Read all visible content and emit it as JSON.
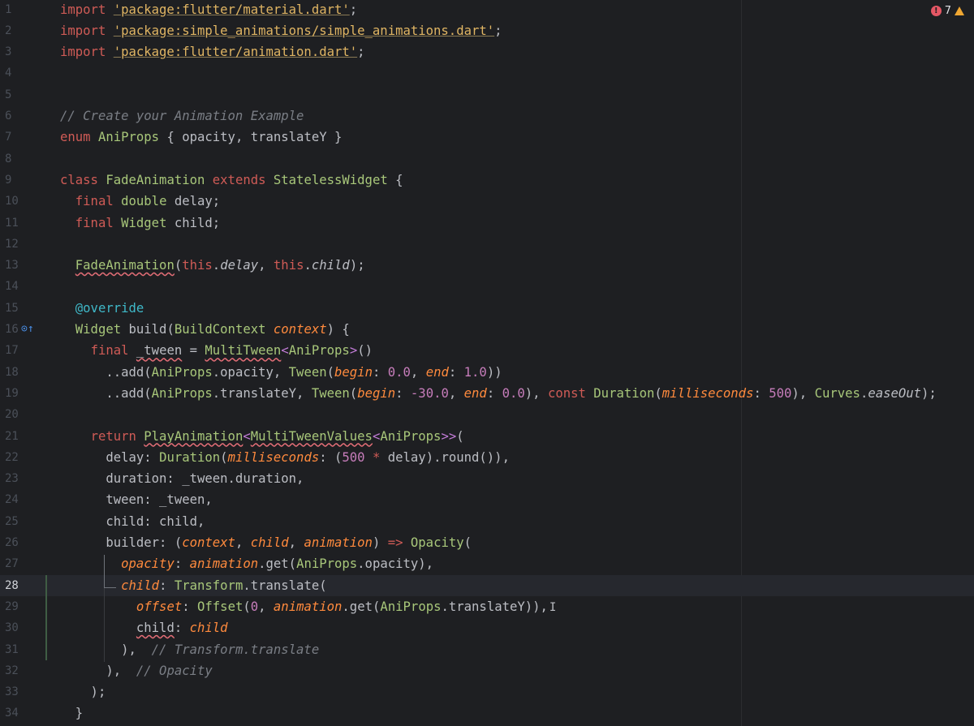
{
  "inspection": {
    "errors": "7",
    "error_icon": "!",
    "colors": {
      "error": "#e55765",
      "warning": "#f0a732"
    }
  },
  "gutter_marks": {
    "line16": "⊙↑"
  },
  "lines": [
    {
      "n": "1",
      "segs": [
        [
          "kw",
          "import "
        ],
        [
          "str",
          "'package:flutter/material.dart'"
        ],
        [
          "plain",
          ";"
        ]
      ]
    },
    {
      "n": "2",
      "segs": [
        [
          "kw",
          "import "
        ],
        [
          "str",
          "'package:simple_animations/simple_animations.dart'"
        ],
        [
          "plain",
          ";"
        ]
      ]
    },
    {
      "n": "3",
      "segs": [
        [
          "kw",
          "import "
        ],
        [
          "str",
          "'package:flutter/animation.dart'"
        ],
        [
          "plain",
          ";"
        ]
      ]
    },
    {
      "n": "4",
      "segs": []
    },
    {
      "n": "5",
      "segs": []
    },
    {
      "n": "6",
      "segs": [
        [
          "cmt",
          "// Create your Animation Example"
        ]
      ]
    },
    {
      "n": "7",
      "segs": [
        [
          "kw",
          "enum "
        ],
        [
          "cls",
          "AniProps"
        ],
        [
          "plain",
          " { opacity, translateY }"
        ]
      ]
    },
    {
      "n": "8",
      "segs": []
    },
    {
      "n": "9",
      "segs": [
        [
          "kw",
          "class "
        ],
        [
          "cls",
          "FadeAnimation "
        ],
        [
          "kw",
          "extends "
        ],
        [
          "cls",
          "StatelessWidget"
        ],
        [
          "plain",
          " {"
        ]
      ]
    },
    {
      "n": "10",
      "segs": [
        [
          "plain",
          "  "
        ],
        [
          "kw",
          "final "
        ],
        [
          "cls",
          "double "
        ],
        [
          "plain",
          "delay;"
        ]
      ]
    },
    {
      "n": "11",
      "segs": [
        [
          "plain",
          "  "
        ],
        [
          "kw",
          "final "
        ],
        [
          "cls",
          "Widget "
        ],
        [
          "plain",
          "child;"
        ]
      ]
    },
    {
      "n": "12",
      "segs": []
    },
    {
      "n": "13",
      "segs": [
        [
          "plain",
          "  "
        ],
        [
          "cls-u",
          "FadeAnimation"
        ],
        [
          "plain",
          "("
        ],
        [
          "kw",
          "this"
        ],
        [
          "plain",
          "."
        ],
        [
          "ital",
          "delay"
        ],
        [
          "plain",
          ", "
        ],
        [
          "kw",
          "this"
        ],
        [
          "plain",
          "."
        ],
        [
          "ital",
          "child"
        ],
        [
          "plain",
          ");"
        ]
      ]
    },
    {
      "n": "14",
      "segs": []
    },
    {
      "n": "15",
      "segs": [
        [
          "plain",
          "  "
        ],
        [
          "anno",
          "@override"
        ]
      ]
    },
    {
      "n": "16",
      "segs": [
        [
          "plain",
          "  "
        ],
        [
          "cls",
          "Widget "
        ],
        [
          "plain",
          "build("
        ],
        [
          "cls",
          "BuildContext "
        ],
        [
          "param",
          "context"
        ],
        [
          "plain",
          ") {"
        ]
      ]
    },
    {
      "n": "17",
      "segs": [
        [
          "plain",
          "    "
        ],
        [
          "kw",
          "final "
        ],
        [
          "plain-u",
          "_tween"
        ],
        [
          "plain",
          " = "
        ],
        [
          "cls-u",
          "MultiTween"
        ],
        [
          "gen",
          "<"
        ],
        [
          "cls",
          "AniProps"
        ],
        [
          "gen",
          ">"
        ],
        [
          "plain",
          "()"
        ]
      ]
    },
    {
      "n": "18",
      "segs": [
        [
          "plain",
          "      ..add("
        ],
        [
          "cls",
          "AniProps"
        ],
        [
          "plain",
          ".opacity, "
        ],
        [
          "cls",
          "Tween"
        ],
        [
          "plain",
          "("
        ],
        [
          "param",
          "begin"
        ],
        [
          "plain",
          ": "
        ],
        [
          "num-l",
          "0.0"
        ],
        [
          "plain",
          ", "
        ],
        [
          "param",
          "end"
        ],
        [
          "plain",
          ": "
        ],
        [
          "num-l",
          "1.0"
        ],
        [
          "plain",
          "))"
        ]
      ]
    },
    {
      "n": "19",
      "segs": [
        [
          "plain",
          "      ..add("
        ],
        [
          "cls",
          "AniProps"
        ],
        [
          "plain",
          ".translateY, "
        ],
        [
          "cls",
          "Tween"
        ],
        [
          "plain",
          "("
        ],
        [
          "param",
          "begin"
        ],
        [
          "plain",
          ": "
        ],
        [
          "num-l",
          "-30.0"
        ],
        [
          "plain",
          ", "
        ],
        [
          "param",
          "end"
        ],
        [
          "plain",
          ": "
        ],
        [
          "num-l",
          "0.0"
        ],
        [
          "plain",
          "), "
        ],
        [
          "kw",
          "const "
        ],
        [
          "cls",
          "Duration"
        ],
        [
          "plain",
          "("
        ],
        [
          "param",
          "milliseconds"
        ],
        [
          "plain",
          ": "
        ],
        [
          "num-l",
          "500"
        ],
        [
          "plain",
          "), "
        ],
        [
          "cls",
          "Curves"
        ],
        [
          "plain",
          "."
        ],
        [
          "ital",
          "easeOut"
        ],
        [
          "plain",
          ");"
        ]
      ]
    },
    {
      "n": "20",
      "segs": []
    },
    {
      "n": "21",
      "segs": [
        [
          "plain",
          "    "
        ],
        [
          "kw",
          "return "
        ],
        [
          "cls-u",
          "PlayAnimation"
        ],
        [
          "gen",
          "<"
        ],
        [
          "cls-u",
          "MultiTweenValues"
        ],
        [
          "gen",
          "<"
        ],
        [
          "cls",
          "AniProps"
        ],
        [
          "gen",
          ">>"
        ],
        [
          "plain",
          "("
        ]
      ]
    },
    {
      "n": "22",
      "segs": [
        [
          "plain",
          "      delay: "
        ],
        [
          "cls",
          "Duration"
        ],
        [
          "plain",
          "("
        ],
        [
          "param",
          "milliseconds"
        ],
        [
          "plain",
          ": ("
        ],
        [
          "num-l",
          "500"
        ],
        [
          "kw",
          " * "
        ],
        [
          "plain",
          "delay).round()),"
        ]
      ]
    },
    {
      "n": "23",
      "segs": [
        [
          "plain",
          "      duration: _tween.duration,"
        ]
      ]
    },
    {
      "n": "24",
      "segs": [
        [
          "plain",
          "      tween: _tween,"
        ]
      ]
    },
    {
      "n": "25",
      "segs": [
        [
          "plain",
          "      child: child,"
        ]
      ]
    },
    {
      "n": "26",
      "segs": [
        [
          "plain",
          "      builder: ("
        ],
        [
          "param",
          "context"
        ],
        [
          "plain",
          ", "
        ],
        [
          "param",
          "child"
        ],
        [
          "plain",
          ", "
        ],
        [
          "param",
          "animation"
        ],
        [
          "plain",
          ") "
        ],
        [
          "kw",
          "=> "
        ],
        [
          "cls",
          "Opacity"
        ],
        [
          "plain",
          "("
        ]
      ]
    },
    {
      "n": "27",
      "segs": [
        [
          "plain",
          "        "
        ],
        [
          "param",
          "opacity"
        ],
        [
          "plain",
          ": "
        ],
        [
          "param",
          "animation"
        ],
        [
          "plain",
          ".get("
        ],
        [
          "cls",
          "AniProps"
        ],
        [
          "plain",
          ".opacity),"
        ]
      ]
    },
    {
      "n": "28",
      "segs": [
        [
          "plain",
          "        "
        ],
        [
          "param",
          "child"
        ],
        [
          "plain",
          ": "
        ],
        [
          "cls",
          "Transform"
        ],
        [
          "plain",
          ".translate("
        ]
      ]
    },
    {
      "n": "29",
      "segs": [
        [
          "plain",
          "          "
        ],
        [
          "param",
          "offset"
        ],
        [
          "plain",
          ": "
        ],
        [
          "cls",
          "Offset"
        ],
        [
          "plain",
          "("
        ],
        [
          "num-l",
          "0"
        ],
        [
          "plain",
          ", "
        ],
        [
          "param",
          "animation"
        ],
        [
          "plain",
          ".get("
        ],
        [
          "cls",
          "AniProps"
        ],
        [
          "plain",
          ".translateY)),"
        ]
      ]
    },
    {
      "n": "30",
      "segs": [
        [
          "plain",
          "          "
        ],
        [
          "plain-u",
          "child"
        ],
        [
          "plain",
          ": "
        ],
        [
          "param",
          "child"
        ]
      ]
    },
    {
      "n": "31",
      "segs": [
        [
          "plain",
          "        ),  "
        ],
        [
          "cmt",
          "// Transform.translate"
        ]
      ]
    },
    {
      "n": "32",
      "segs": [
        [
          "plain",
          "      ),  "
        ],
        [
          "cmt",
          "// Opacity"
        ]
      ]
    },
    {
      "n": "33",
      "segs": [
        [
          "plain",
          "    );"
        ]
      ]
    },
    {
      "n": "34",
      "segs": [
        [
          "plain",
          "  }"
        ]
      ]
    }
  ],
  "current_line": "28"
}
